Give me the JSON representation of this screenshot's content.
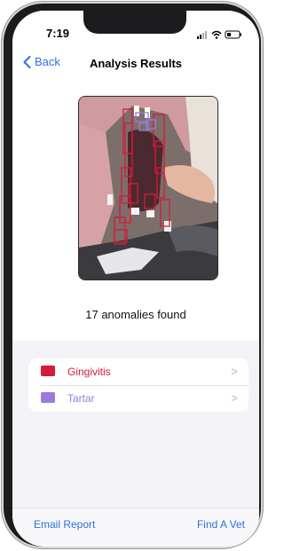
{
  "status": {
    "time": "7:19"
  },
  "nav": {
    "back_label": "Back",
    "title": "Analysis Results"
  },
  "summary": {
    "count_text": "17 anomalies found"
  },
  "findings": [
    {
      "label": "Gingivitis",
      "color": "#d7193a"
    },
    {
      "label": "Tartar",
      "color": "#9b7be0"
    }
  ],
  "toolbar": {
    "email_label": "Email Report",
    "vet_label": "Find A Vet"
  },
  "colors": {
    "accent": "#2f6fe0"
  }
}
